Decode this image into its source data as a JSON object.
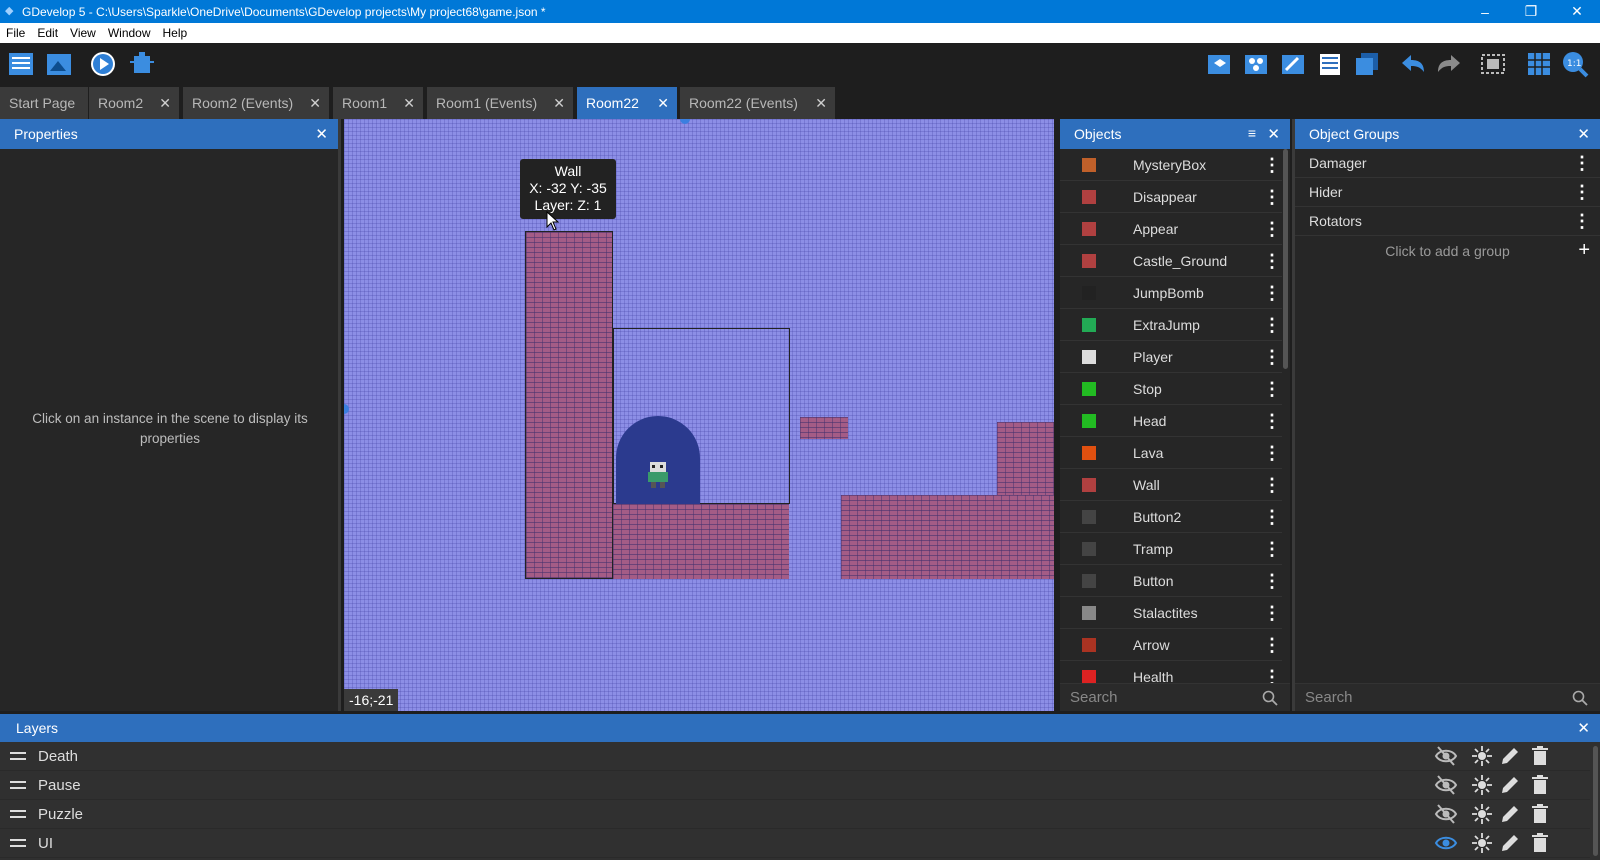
{
  "window": {
    "title": "GDevelop 5 - C:\\Users\\Sparkle\\OneDrive\\Documents\\GDevelop projects\\My project68\\game.json *",
    "controls": [
      "–",
      "❐",
      "✕"
    ]
  },
  "menu": [
    "File",
    "Edit",
    "View",
    "Window",
    "Help"
  ],
  "tabs": [
    {
      "label": "Start Page",
      "closable": false
    },
    {
      "label": "Room2",
      "closable": true
    },
    {
      "label": "Room2 (Events)",
      "closable": true
    },
    {
      "label": "Room1",
      "closable": true
    },
    {
      "label": "Room1 (Events)",
      "closable": true
    },
    {
      "label": "Room22",
      "closable": true,
      "active": true
    },
    {
      "label": "Room22 (Events)",
      "closable": true
    }
  ],
  "properties": {
    "title": "Properties",
    "message": "Click on an instance in the scene to display its properties"
  },
  "scene": {
    "tooltip": {
      "name": "Wall",
      "pos": "X: -32  Y: -35",
      "layer": "Layer:   Z: 1"
    },
    "cursor_coords": "-16;-21"
  },
  "objects": {
    "title": "Objects",
    "items": [
      {
        "name": "MysteryBox",
        "thumb": "#c0602a"
      },
      {
        "name": "Disappear",
        "thumb": "#b04040"
      },
      {
        "name": "Appear",
        "thumb": "#b04040"
      },
      {
        "name": "Castle_Ground",
        "thumb": "#b04040"
      },
      {
        "name": "JumpBomb",
        "thumb": "#222222"
      },
      {
        "name": "ExtraJump",
        "thumb": "#22aa55"
      },
      {
        "name": "Player",
        "thumb": "#dddddd"
      },
      {
        "name": "Stop",
        "thumb": "#22bb22"
      },
      {
        "name": "Head",
        "thumb": "#22bb22"
      },
      {
        "name": "Lava",
        "thumb": "#e05010"
      },
      {
        "name": "Wall",
        "thumb": "#b04040"
      },
      {
        "name": "Button2",
        "thumb": "#444444"
      },
      {
        "name": "Tramp",
        "thumb": "#444444"
      },
      {
        "name": "Button",
        "thumb": "#444444"
      },
      {
        "name": "Stalactites",
        "thumb": "#888888"
      },
      {
        "name": "Arrow",
        "thumb": "#aa3322"
      },
      {
        "name": "Health",
        "thumb": "#dd2222"
      }
    ],
    "search_placeholder": "Search"
  },
  "groups": {
    "title": "Object Groups",
    "items": [
      "Damager",
      "Hider",
      "Rotators"
    ],
    "add_label": "Click to add a group",
    "search_placeholder": "Search"
  },
  "layers": {
    "title": "Layers",
    "items": [
      {
        "name": "Death",
        "visible": false
      },
      {
        "name": "Pause",
        "visible": false
      },
      {
        "name": "Puzzle",
        "visible": false
      },
      {
        "name": "UI",
        "visible": true
      }
    ]
  },
  "colors": {
    "accent": "#2e6fbd",
    "titlebar": "#0078d7",
    "scene_bg": "#8c8ee6",
    "brick": "#a45c86"
  }
}
